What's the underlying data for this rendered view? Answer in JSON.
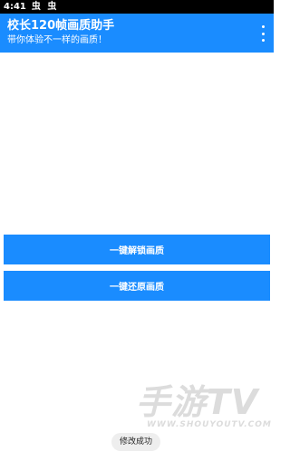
{
  "status_bar": {
    "time": "4:41",
    "notification_icons": "🐛🐛"
  },
  "app_bar": {
    "title": "校长120帧画质助手",
    "subtitle": "带你体验不一样的画质！"
  },
  "buttons": {
    "unlock_label": "一键解锁画质",
    "restore_label": "一键还原画质"
  },
  "watermark": {
    "brand": "手游TV",
    "url": "WWW.SHOUYOUTV.COM"
  },
  "toast": {
    "message": "修改成功"
  },
  "colors": {
    "accent": "#1a8cff",
    "status_bar": "#000000",
    "background": "#ffffff"
  }
}
